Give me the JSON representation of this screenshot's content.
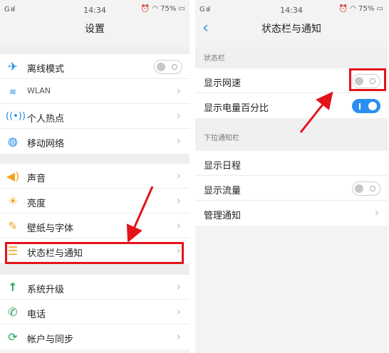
{
  "left": {
    "status": {
      "signal": "G ııl",
      "time": "14:34",
      "battery": "75%"
    },
    "title": "设置",
    "groups": [
      [
        {
          "label": "离线模式",
          "icon": "airplane-icon",
          "toggle": "off"
        },
        {
          "label": "WLAN",
          "icon": "wifi-icon",
          "chevron": true
        },
        {
          "label": "个人热点",
          "icon": "hotspot-icon",
          "chevron": true
        },
        {
          "label": "移动网络",
          "icon": "globe-icon",
          "chevron": true
        }
      ],
      [
        {
          "label": "声音",
          "icon": "speaker-icon",
          "chevron": true
        },
        {
          "label": "亮度",
          "icon": "brightness-icon",
          "chevron": true
        },
        {
          "label": "壁纸与字体",
          "icon": "brush-icon",
          "chevron": true
        },
        {
          "label": "状态栏与通知",
          "icon": "statusbar-icon",
          "chevron": true
        }
      ],
      [
        {
          "label": "系统升级",
          "icon": "upgrade-arrow-icon",
          "chevron": true
        },
        {
          "label": "电话",
          "icon": "phone-icon",
          "chevron": true
        },
        {
          "label": "帐户与同步",
          "icon": "sync-icon",
          "chevron": true
        }
      ]
    ]
  },
  "right": {
    "status": {
      "signal": "G ııl",
      "time": "14:34",
      "battery": "75%"
    },
    "title": "状态栏与通知",
    "sections": [
      {
        "header": "状态栏",
        "rows": [
          {
            "label": "显示网速",
            "toggle": "off"
          },
          {
            "label": "显示电量百分比",
            "toggle": "on"
          }
        ]
      },
      {
        "header": "下拉通知栏",
        "rows": [
          {
            "label": "显示日程"
          },
          {
            "label": "显示流量",
            "toggle": "off"
          },
          {
            "label": "管理通知",
            "chevron": true
          }
        ]
      }
    ]
  },
  "colors": {
    "accent": "#2b8ff1",
    "highlight": "#e3131a"
  }
}
